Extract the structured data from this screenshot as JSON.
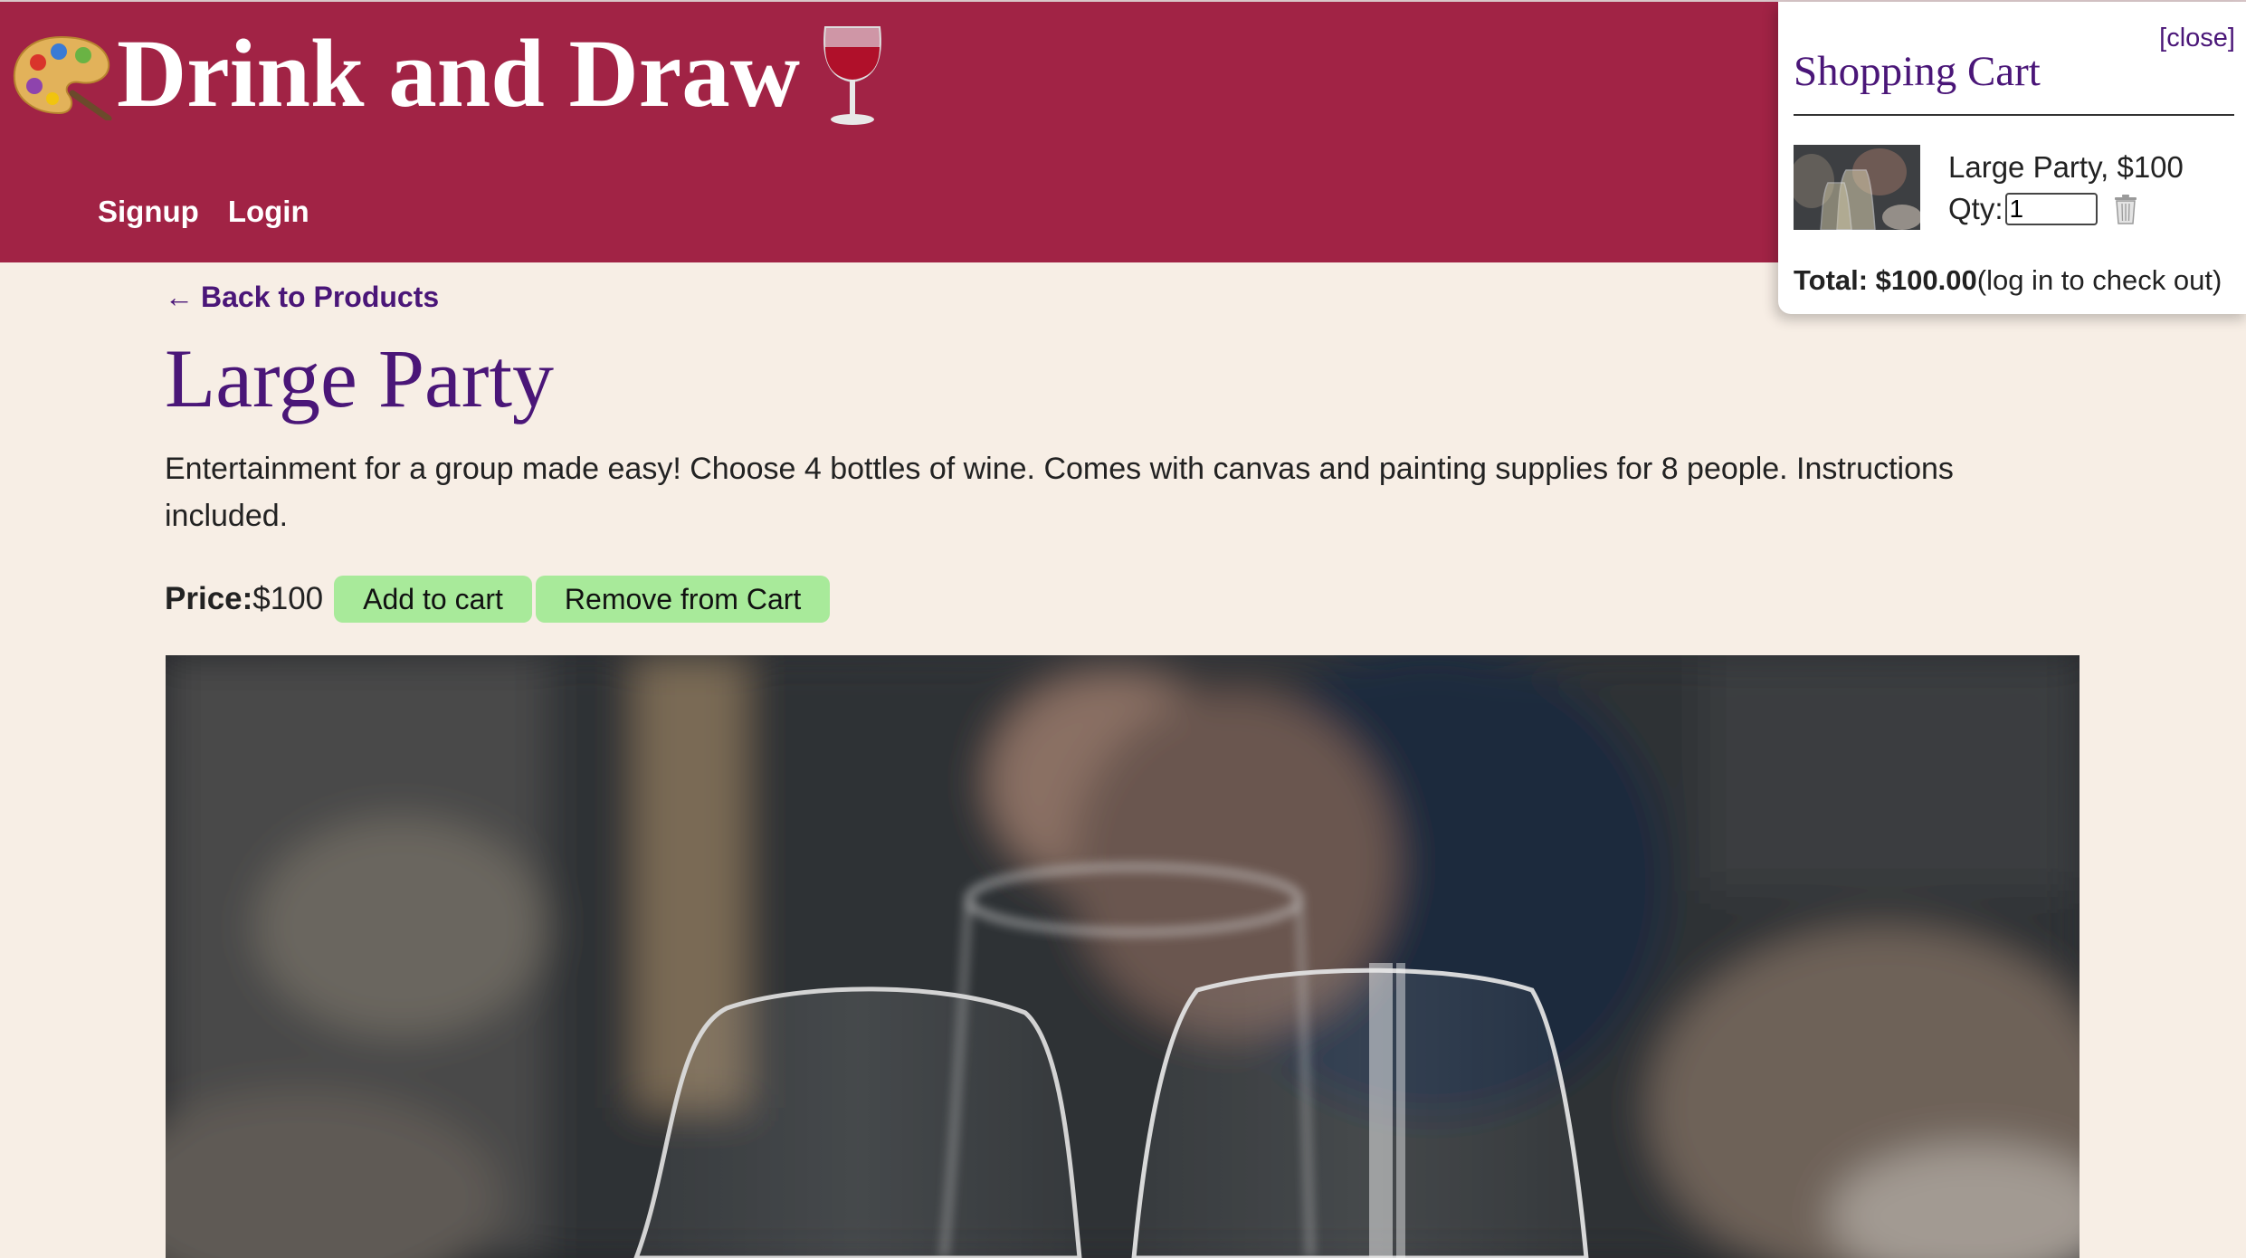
{
  "header": {
    "title": "Drink and Draw",
    "palette_icon": "artist-palette-icon",
    "wine_icon": "wine-glass-icon",
    "nav": [
      {
        "label": "Signup"
      },
      {
        "label": "Login"
      }
    ]
  },
  "product": {
    "back_link": "Back to Products",
    "back_arrow": "←",
    "title": "Large Party",
    "description": "Entertainment for a group made easy! Choose 4 bottles of wine. Comes with canvas and painting supplies for 8 people. Instructions included.",
    "price_label": "Price:",
    "price_value": "$100",
    "add_to_cart_label": "Add to cart",
    "remove_from_cart_label": "Remove from Cart"
  },
  "cart": {
    "close_label": "[close]",
    "title": "Shopping Cart",
    "items": [
      {
        "name": "Large Party, $100",
        "qty_label": "Qty:",
        "qty_value": "1"
      }
    ],
    "total_label": "Total: $100.00",
    "total_note": "(log in to check out)"
  },
  "colors": {
    "header_bg": "#a12345",
    "page_bg": "#f7eee5",
    "accent_purple": "#4a1678",
    "button_green": "#a8ea9a"
  }
}
